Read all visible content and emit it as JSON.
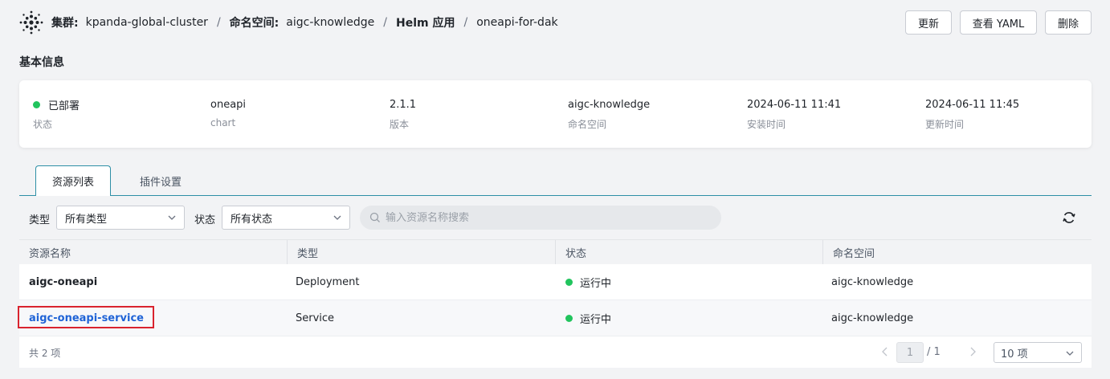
{
  "header": {
    "cluster_label": "集群:",
    "cluster_value": "kpanda-global-cluster",
    "separator": "/",
    "namespace_label": "命名空间:",
    "namespace_value": "aigc-knowledge",
    "helm_label": "Helm 应用",
    "app_name": "oneapi-for-dak",
    "buttons": {
      "update": "更新",
      "view_yaml": "查看 YAML",
      "delete": "删除"
    }
  },
  "basic_info": {
    "title": "基本信息",
    "items": [
      {
        "value": "已部署",
        "label": "状态"
      },
      {
        "value": "oneapi",
        "label": "chart"
      },
      {
        "value": "2.1.1",
        "label": "版本"
      },
      {
        "value": "aigc-knowledge",
        "label": "命名空间"
      },
      {
        "value": "2024-06-11 11:41",
        "label": "安装时间"
      },
      {
        "value": "2024-06-11 11:45",
        "label": "更新时间"
      }
    ]
  },
  "tabs": [
    {
      "label": "资源列表",
      "active": true
    },
    {
      "label": "插件设置",
      "active": false
    }
  ],
  "filters": {
    "type_label": "类型",
    "type_value": "所有类型",
    "status_label": "状态",
    "status_value": "所有状态",
    "search_placeholder": "输入资源名称搜索"
  },
  "table": {
    "columns": [
      "资源名称",
      "类型",
      "状态",
      "命名空间"
    ],
    "rows": [
      {
        "name": "aigc-oneapi",
        "type": "Deployment",
        "status": "运行中",
        "namespace": "aigc-knowledge"
      },
      {
        "name": "aigc-oneapi-service",
        "type": "Service",
        "status": "运行中",
        "namespace": "aigc-knowledge"
      }
    ]
  },
  "pagination": {
    "total": "共 2 项",
    "current_page": "1",
    "page_total": "/ 1",
    "page_size": "10 项"
  },
  "colors": {
    "accent": "#2d8fa6",
    "status_ok": "#21c45d",
    "link": "#1f63d6",
    "highlight": "#d9232e"
  }
}
